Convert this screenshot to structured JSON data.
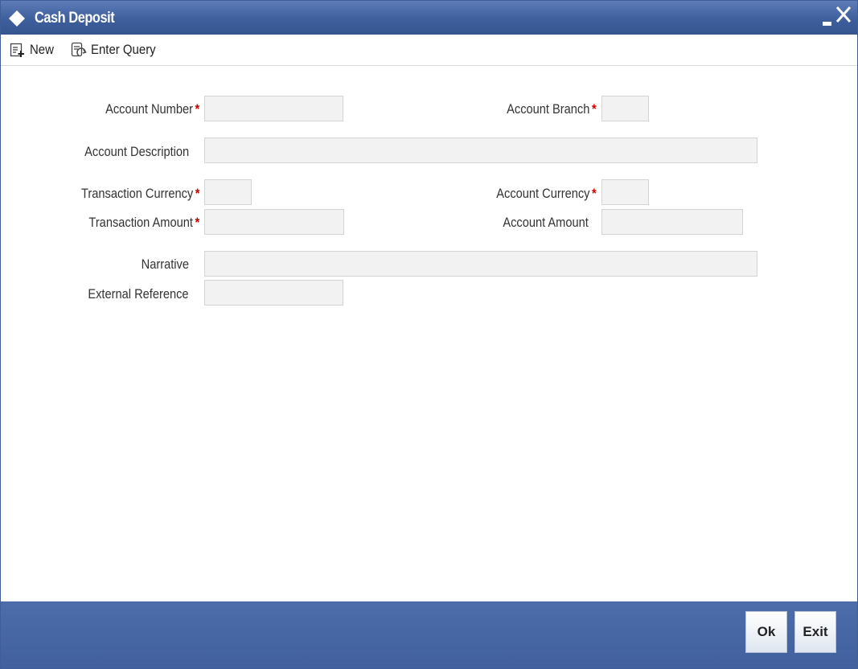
{
  "window": {
    "title": "Cash Deposit",
    "icons": [
      "diamond-icon",
      "minimize-icon",
      "close-icon"
    ],
    "close_glyph": "X"
  },
  "toolbar": {
    "new_label": "New",
    "enter_query_label": "Enter Query"
  },
  "form": {
    "account_number_label": "Account Number",
    "account_branch_label": "Account Branch",
    "account_description_label": "Account Description",
    "transaction_currency_label": "Transaction Currency",
    "account_currency_label": "Account Currency",
    "transaction_amount_label": "Transaction Amount",
    "account_amount_label": "Account Amount",
    "narrative_label": "Narrative",
    "external_reference_label": "External Reference",
    "required_mark": "*"
  },
  "footer": {
    "ok_label": "Ok",
    "exit_label": "Exit"
  },
  "colors": {
    "header_blue": "#3e5f9c",
    "required_red": "#cc0000",
    "field_bg": "#f2f2f2"
  }
}
